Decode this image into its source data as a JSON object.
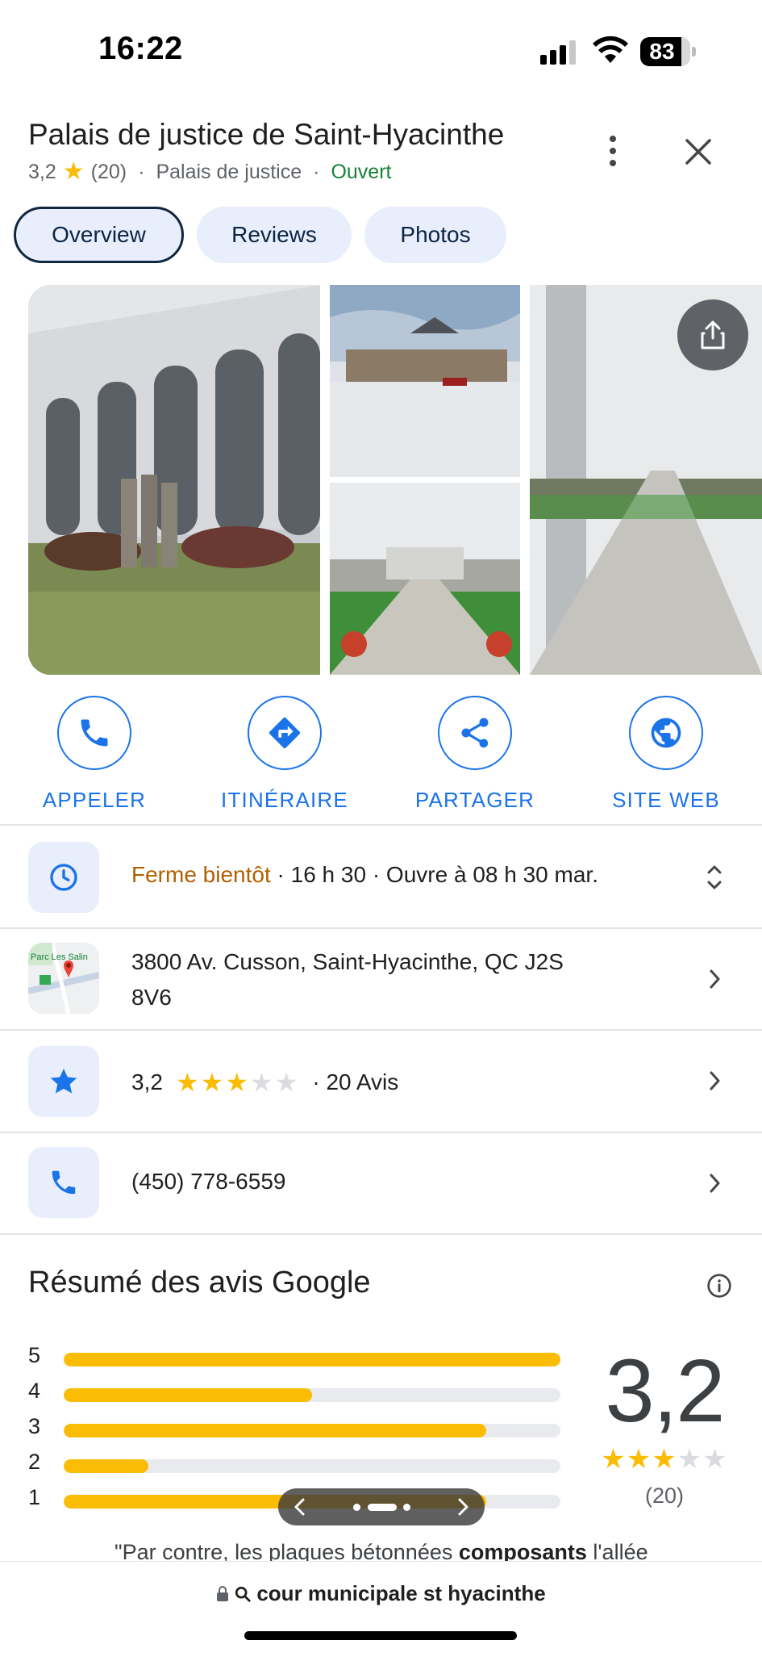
{
  "status_bar": {
    "time": "16:22",
    "battery": "83",
    "battery_level": 0.83
  },
  "place": {
    "title": "Palais de justice de Saint-Hyacinthe",
    "rating": "3,2",
    "review_count": "(20)",
    "category": "Palais de justice",
    "open_status": "Ouvert",
    "separator": "·"
  },
  "tabs": [
    {
      "label": "Overview",
      "active": true
    },
    {
      "label": "Reviews",
      "active": false
    },
    {
      "label": "Photos",
      "active": false
    }
  ],
  "actions": [
    {
      "label": "APPELER",
      "icon": "phone-icon"
    },
    {
      "label": "ITINÉRAIRE",
      "icon": "directions-icon"
    },
    {
      "label": "PARTAGER",
      "icon": "share-icon"
    },
    {
      "label": "SITE WEB",
      "icon": "globe-icon"
    }
  ],
  "hours": {
    "status": "Ferme bientôt",
    "detail": " · 16 h 30 · Ouvre à 08 h 30 mar."
  },
  "address": {
    "line1": "3800 Av. Cusson, Saint-Hyacinthe, QC J2S",
    "line2": "8V6",
    "map_label": "Parc Les Salin"
  },
  "rating_row": {
    "value": "3,2",
    "stars_filled": 3,
    "stars_total": 5,
    "reviews": "· 20 Avis"
  },
  "phone": {
    "number": "(450) 778-6559"
  },
  "review_summary": {
    "title": "Résumé des avis Google",
    "score": "3,2",
    "count": "(20)",
    "distribution": [
      {
        "stars": "5",
        "fraction": 1.0
      },
      {
        "stars": "4",
        "fraction": 0.5
      },
      {
        "stars": "3",
        "fraction": 0.85
      },
      {
        "stars": "2",
        "fraction": 0.17
      },
      {
        "stars": "1",
        "fraction": 0.85
      }
    ],
    "quote_start": "\"Par contre, les plaques bétonnées ",
    "quote_bold": "composants",
    "quote_end": " l'allée"
  },
  "url_bar": {
    "text": "cour municipale st hyacinthe"
  },
  "colors": {
    "accent": "#1a73e8",
    "star": "#fbbc04",
    "open_green": "#188038",
    "closing_orange": "#b06000"
  }
}
